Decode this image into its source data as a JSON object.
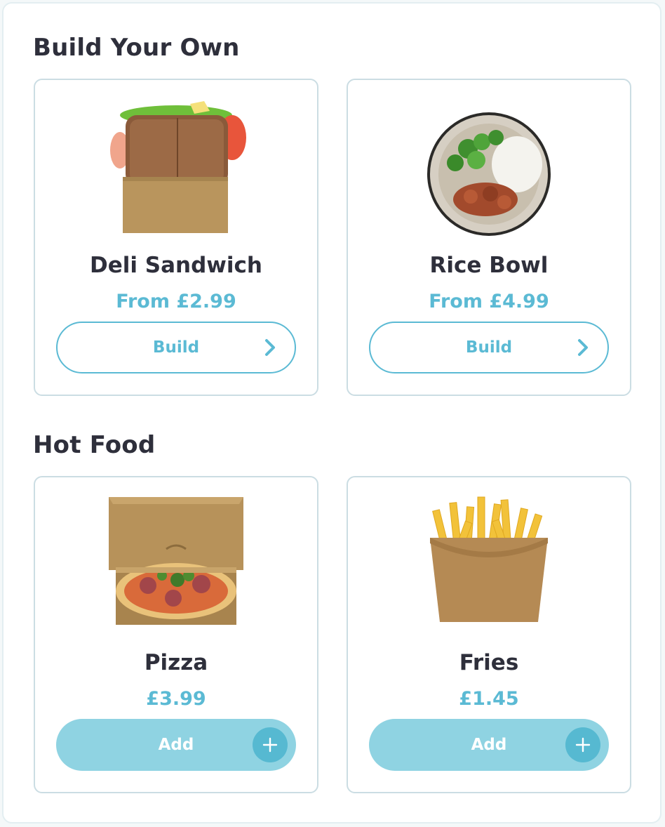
{
  "sections": [
    {
      "title": "Build Your Own",
      "items": [
        {
          "name": "Deli Sandwich",
          "price": "From £2.99",
          "action": "Build",
          "icon": "chevron-right-icon"
        },
        {
          "name": "Rice Bowl",
          "price": "From £4.99",
          "action": "Build",
          "icon": "chevron-right-icon"
        }
      ]
    },
    {
      "title": "Hot Food",
      "items": [
        {
          "name": "Pizza",
          "price": "£3.99",
          "action": "Add",
          "icon": "plus-icon"
        },
        {
          "name": "Fries",
          "price": "£1.45",
          "action": "Add",
          "icon": "plus-icon"
        }
      ]
    }
  ],
  "colors": {
    "accent": "#5bbad4",
    "button_fill": "#8fd3e2",
    "plus_circle": "#56b9d1",
    "card_border": "#cbdde3",
    "title_text": "#2e2f3b"
  }
}
